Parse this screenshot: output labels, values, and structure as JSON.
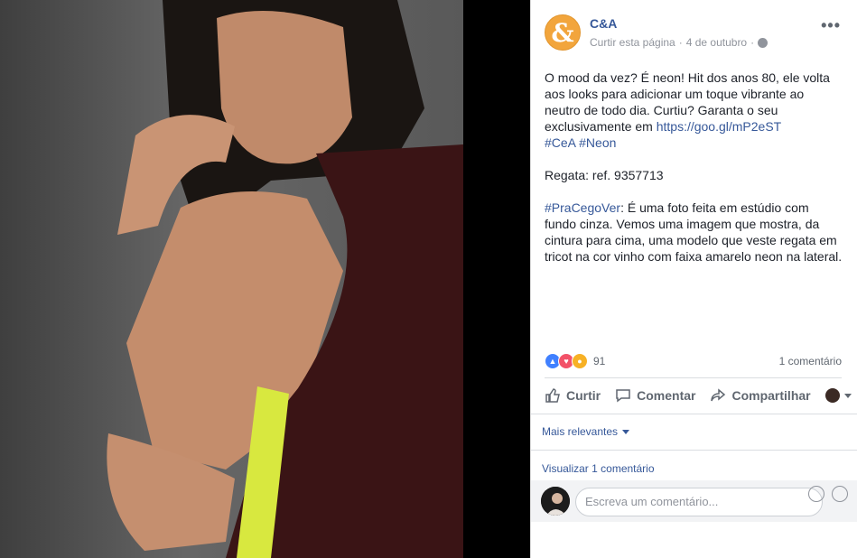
{
  "post": {
    "page_name": "C&A",
    "logo_glyph": "&",
    "like_page_label": "Curtir esta página",
    "date": "4 de outubro",
    "separator": "·",
    "more_label": "•••",
    "text_line1": "O mood da vez? É neon! Hit dos anos 80, ele volta aos looks para adicionar um toque vibrante ao neutro de todo dia. Curtiu? Garanta o seu exclusivamente em ",
    "link": "https://goo.gl/mP2eST",
    "hashtags": "#CeA #Neon",
    "ref": "Regata: ref. 9357713",
    "accessibility_tag": "#PraCegoVer",
    "accessibility_text": ": É uma foto feita em estúdio com fundo cinza. Vemos uma imagem que mostra, da cintura para cima, uma modelo que veste regata em tricot na cor vinho com faixa amarelo neon na lateral."
  },
  "stats": {
    "reaction_count": "91",
    "comment_count_label": "1 comentário"
  },
  "actions": {
    "like": "Curtir",
    "comment": "Comentar",
    "share": "Compartilhar"
  },
  "comments": {
    "sort_label": "Mais relevantes",
    "view_more": "Visualizar 1 comentário",
    "placeholder": "Escreva um comentário..."
  },
  "colors": {
    "link": "#365899",
    "like": "#4080ff",
    "love": "#f25268",
    "angry": "#f7b125",
    "page_logo": "#f2a53c",
    "shirt": "#3a1415",
    "neon_stripe": "#d8e83f"
  }
}
